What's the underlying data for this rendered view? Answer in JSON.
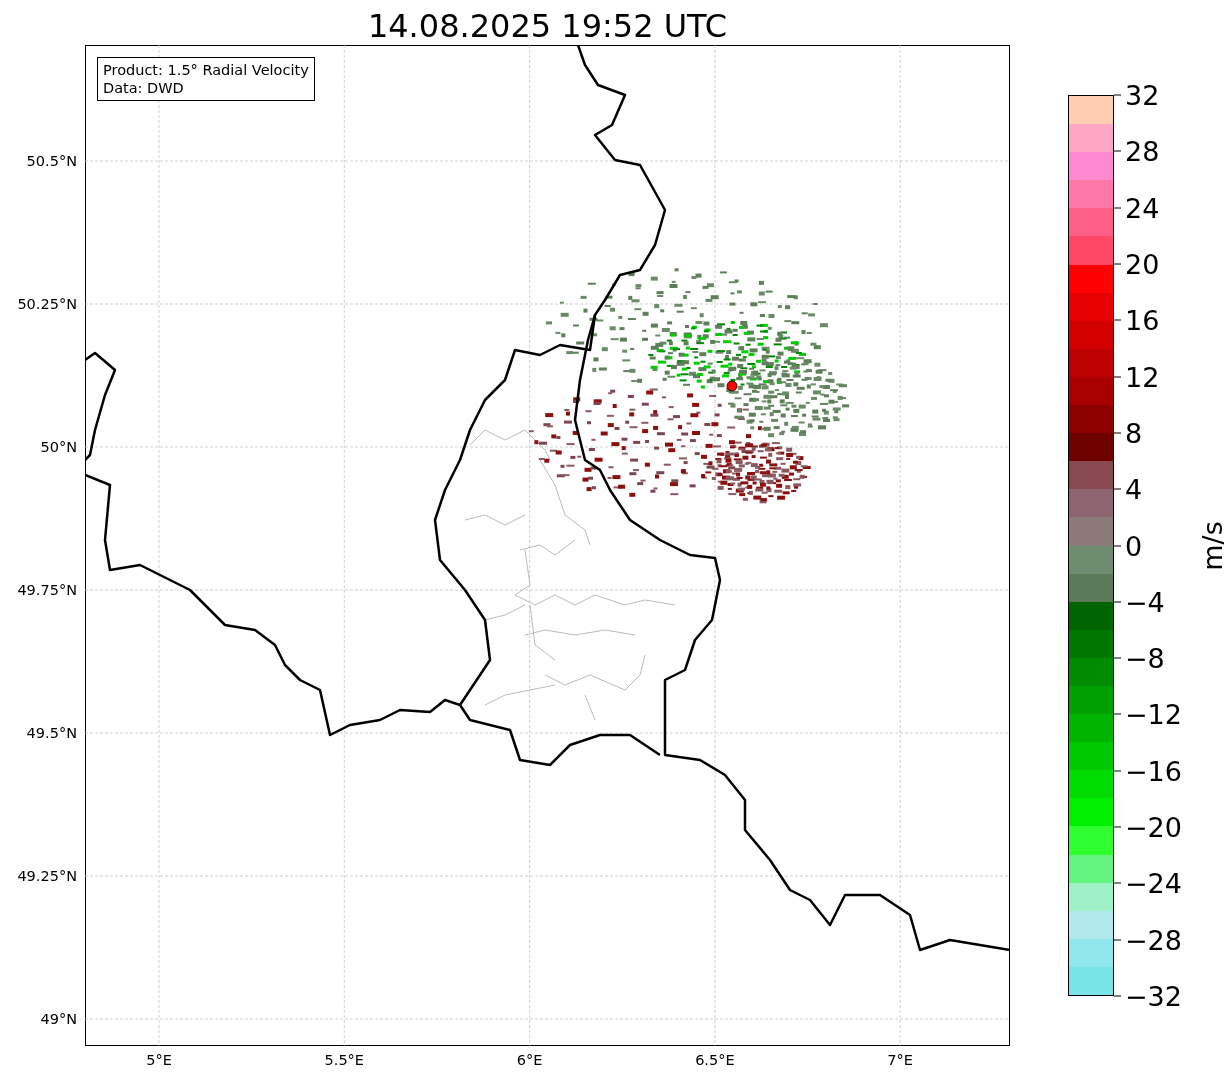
{
  "title": "14.08.2025 19:52 UTC",
  "info_box": [
    "Product: 1.5° Radial Velocity",
    "Data: DWD"
  ],
  "map": {
    "lat_labels": [
      "50.5°N",
      "50.25°N",
      "50°N",
      "49.75°N",
      "49.5°N",
      "49.25°N",
      "49°N"
    ],
    "lon_labels": [
      "5°E",
      "5.5°E",
      "6°E",
      "6.5°E",
      "7°E"
    ]
  },
  "colorbar": {
    "label": "m/s",
    "ticks": [
      "32",
      "28",
      "24",
      "20",
      "16",
      "12",
      "8",
      "4",
      "0",
      "−4",
      "−8",
      "−12",
      "−16",
      "−20",
      "−24",
      "−28",
      "−32"
    ],
    "segments": [
      {
        "color": "#ffcdb0"
      },
      {
        "color": "#ffa6c4"
      },
      {
        "color": "#ff88d0"
      },
      {
        "color": "#ff78a8"
      },
      {
        "color": "#ff6088"
      },
      {
        "color": "#ff4866"
      },
      {
        "color": "#ff0000"
      },
      {
        "color": "#e60000"
      },
      {
        "color": "#d20000"
      },
      {
        "color": "#be0000"
      },
      {
        "color": "#a80000"
      },
      {
        "color": "#8c0000"
      },
      {
        "color": "#6e0000"
      },
      {
        "color": "#884a50"
      },
      {
        "color": "#8c6570"
      },
      {
        "color": "#8c7a78"
      },
      {
        "color": "#6e8c70"
      },
      {
        "color": "#5a7a58"
      },
      {
        "color": "#006400"
      },
      {
        "color": "#007800"
      },
      {
        "color": "#008c00"
      },
      {
        "color": "#00a000"
      },
      {
        "color": "#00b400"
      },
      {
        "color": "#00c800"
      },
      {
        "color": "#00dc00"
      },
      {
        "color": "#00f000"
      },
      {
        "color": "#30ff30"
      },
      {
        "color": "#64f580"
      },
      {
        "color": "#a0f0c8"
      },
      {
        "color": "#b0e8ec"
      },
      {
        "color": "#90e8ec"
      },
      {
        "color": "#78e4e8"
      }
    ]
  }
}
